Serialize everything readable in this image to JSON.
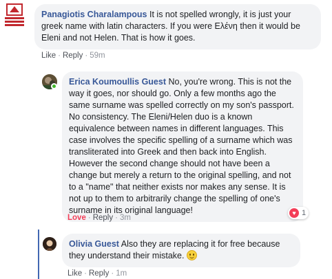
{
  "comments": [
    {
      "author": "Panagiotis Charalampous",
      "text": "It is not spelled wrongly, it is just your greek name with latin characters. If you were Ελένη then it would be Eleni and not Helen. That is how it goes.",
      "actions": {
        "like": "Like",
        "reply": "Reply",
        "time": "59m"
      }
    },
    {
      "author": "Erica Koumoullis Guest",
      "text": "No, you're wrong. This is not the way it goes, nor should go. Only a few months ago the same surname was spelled correctly on my son's passport. No consistency. The Eleni/Helen duo is a known equivalence between names in different languages. This case involves the specific spelling of a surname which was transliterated into Greek and then back into English. However the second change should not have been a change but merely a return to the original spelling, and not to a \"name\" that neither exists nor makes any sense. It is not up to them to arbitrarily change the spelling of one's surname in its original language!",
      "actions": {
        "like": "Love",
        "reply": "Reply",
        "time": "3m"
      },
      "reaction_count": "1"
    },
    {
      "author": "Olivia Guest",
      "text": "Also they are replacing it for free because they understand their mistake.",
      "actions": {
        "like": "Like",
        "reply": "Reply",
        "time": "1m"
      }
    }
  ],
  "separator": "·",
  "colors": {
    "author": "#385898",
    "love": "#f33e58",
    "bubble": "#f2f3f5",
    "thread": "#4267b2"
  },
  "icons": [
    "organization-logo-avatar",
    "user-avatar",
    "online-status-dot",
    "heart-reaction-icon",
    "smiley-emoji-icon"
  ]
}
